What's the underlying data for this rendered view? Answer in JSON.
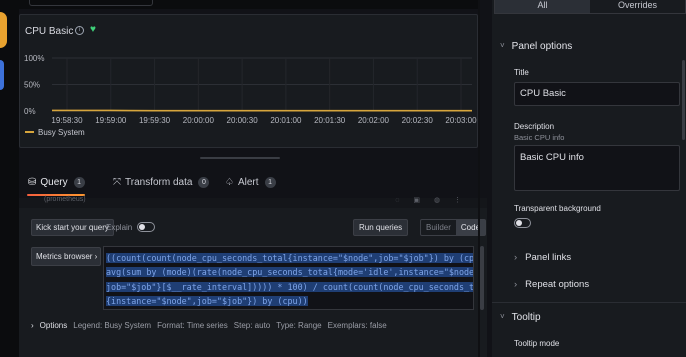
{
  "panel": {
    "title": "CPU Basic",
    "info_icon": "info-icon",
    "health_icon": "heart-icon",
    "health_color": "#3fd17a"
  },
  "chart_data": {
    "type": "line",
    "title": "",
    "x": [
      "19:58:30",
      "19:59:00",
      "19:59:30",
      "20:00:00",
      "20:00:30",
      "20:01:00",
      "20:01:30",
      "20:02:00",
      "20:02:30",
      "20:03:00"
    ],
    "y_ticks": [
      "100%",
      "50%",
      "0%"
    ],
    "ylim": [
      0,
      100
    ],
    "grid": true,
    "legend_position": "bottom-left",
    "series": [
      {
        "name": "Busy System",
        "color": "#d6a53c",
        "values": [
          1,
          1,
          0.5,
          0.5,
          0.5,
          0.5,
          0.5,
          0.5,
          0.5,
          0.5
        ]
      }
    ]
  },
  "tabs": [
    {
      "label": "Query",
      "count": "1",
      "icon": "database-icon"
    },
    {
      "label": "Transform data",
      "count": "0",
      "icon": "transform-icon"
    },
    {
      "label": "Alert",
      "count": "1",
      "icon": "bell-icon"
    }
  ],
  "query": {
    "ghost_text": "(prometheus)",
    "kick_start": "Kick start your query",
    "explain": "Explain",
    "run_queries": "Run queries",
    "builder": "Builder",
    "code": "Code",
    "metrics_browser": "Metrics browser ›",
    "code_lines": [
      "((count(count(node_cpu_seconds_total{instance=\"$node\",job=\"$job\"}) by (cpu))) -",
      "avg(sum by (mode)(rate(node_cpu_seconds_total{mode='idle',instance=\"$node\",",
      "job=\"$job\"}[$__rate_interval])))) * 100) / count(count(node_cpu_seconds_total",
      "{instance=\"$node\",job=\"$job\"}) by (cpu))"
    ],
    "options_label": "Options",
    "options_summary": [
      "Legend: Busy System",
      "Format: Time series",
      "Step: auto",
      "Type: Range",
      "Exemplars: false"
    ]
  },
  "sidebar": {
    "tab_all": "All",
    "tab_overrides": "Overrides",
    "panel_options": "Panel options",
    "title_label": "Title",
    "title_value": "CPU Basic",
    "description_label": "Description",
    "description_sub": "Basic CPU info",
    "description_value": "Basic CPU info",
    "transparent_label": "Transparent background",
    "panel_links": "Panel links",
    "repeat_options": "Repeat options",
    "tooltip": "Tooltip",
    "tooltip_mode": "Tooltip mode"
  }
}
